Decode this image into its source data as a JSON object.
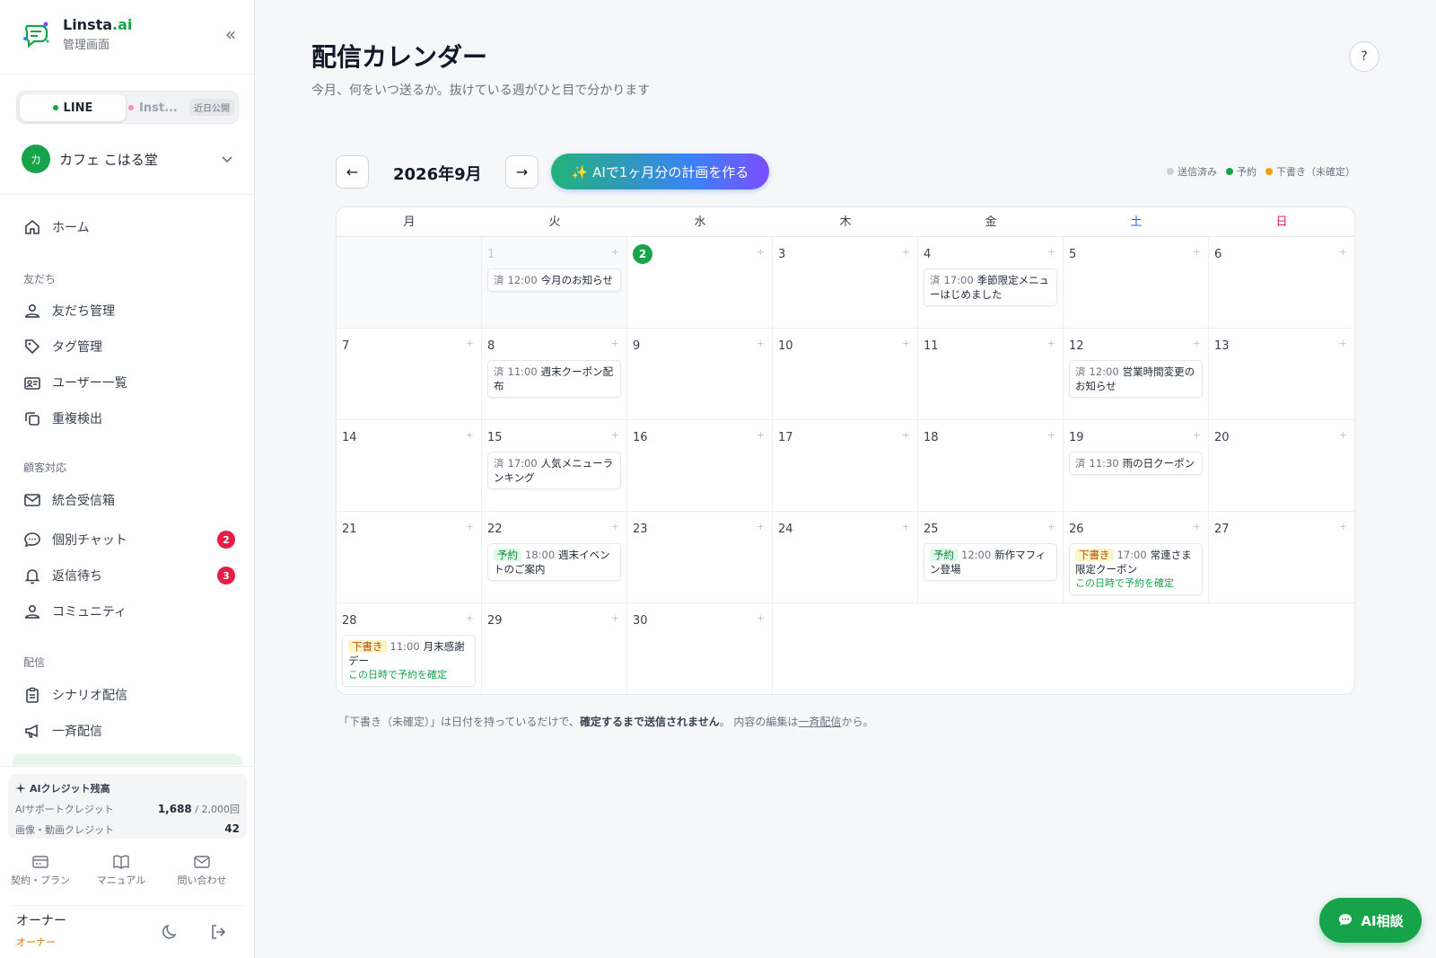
{
  "brand": {
    "name_main": "Linsta",
    "name_accent": ".ai",
    "subtitle": "管理画面"
  },
  "channel_switch": {
    "line": "LINE",
    "instagram": "Inst...",
    "instagram_badge": "近日公開"
  },
  "account": {
    "initial": "カ",
    "name": "カフェ こはる堂"
  },
  "nav": {
    "home": "ホーム",
    "section_friends": "友だち",
    "friends_manage": "友だち管理",
    "tag_manage": "タグ管理",
    "user_list": "ユーザー一覧",
    "duplicate_detect": "重複検出",
    "section_support": "顧客対応",
    "inbox": "統合受信箱",
    "chat": "個別チャット",
    "chat_badge": "2",
    "waiting": "返信待ち",
    "waiting_badge": "3",
    "community": "コミュニティ",
    "section_delivery": "配信",
    "scenario": "シナリオ配信",
    "broadcast": "一斉配信"
  },
  "credits": {
    "title": "AIクレジット残高",
    "support_label": "AIサポートクレジット",
    "support_value": "1,688",
    "support_max": " / 2,000回",
    "media_label": "画像・動画クレジット",
    "media_value": "42"
  },
  "footer": {
    "plan": "契約・プラン",
    "manual": "マニュアル",
    "contact": "問い合わせ"
  },
  "owner": {
    "name": "オーナー",
    "role": "オーナー"
  },
  "header": {
    "title": "配信カレンダー",
    "subtitle": "今月、何をいつ送るか。抜けている週がひと目で分かります",
    "help": "?"
  },
  "toolbar": {
    "prev": "←",
    "month": "2026年9月",
    "next": "→",
    "ai_plan": "✨ AIで1ヶ月分の計画を作る"
  },
  "legend": {
    "sent": "送信済み",
    "scheduled": "予約",
    "draft": "下書き（未確定）"
  },
  "colors": {
    "sent": "#cbd0d6",
    "scheduled": "#16a34a",
    "draft": "#f59e0b",
    "accent": "#16a34a"
  },
  "weekdays": [
    "月",
    "火",
    "水",
    "木",
    "金",
    "土",
    "日"
  ],
  "labels": {
    "sent": "済",
    "scheduled": "予約",
    "draft": "下書き",
    "confirm": "この日時で予約を確定",
    "plus": "+"
  },
  "days": {
    "d1": "1",
    "d2": "2",
    "d3": "3",
    "d4": "4",
    "d5": "5",
    "d6": "6",
    "d7": "7",
    "d8": "8",
    "d9": "9",
    "d10": "10",
    "d11": "11",
    "d12": "12",
    "d13": "13",
    "d14": "14",
    "d15": "15",
    "d16": "16",
    "d17": "17",
    "d18": "18",
    "d19": "19",
    "d20": "20",
    "d21": "21",
    "d22": "22",
    "d23": "23",
    "d24": "24",
    "d25": "25",
    "d26": "26",
    "d27": "27",
    "d28": "28",
    "d29": "29",
    "d30": "30"
  },
  "events": {
    "e1": {
      "time": "12:00",
      "title": "今月のお知らせ"
    },
    "e4": {
      "time": "17:00",
      "title": "季節限定メニューはじめました"
    },
    "e8": {
      "time": "11:00",
      "title": "週末クーポン配布"
    },
    "e12": {
      "time": "12:00",
      "title": "営業時間変更のお知らせ"
    },
    "e15": {
      "time": "17:00",
      "title": "人気メニューランキング"
    },
    "e19": {
      "time": "11:30",
      "title": "雨の日クーポン"
    },
    "e22": {
      "time": "18:00",
      "title": "週末イベントのご案内"
    },
    "e25": {
      "time": "12:00",
      "title": "新作マフィン登場"
    },
    "e26": {
      "time": "17:00",
      "title": "常連さま限定クーポン"
    },
    "e28": {
      "time": "11:00",
      "title": "月末感謝デー"
    }
  },
  "note": {
    "part1": "「下書き（未確定）」は日付を持っているだけで、",
    "bold": "確定するまで送信されません",
    "part2": "。 内容の編集は",
    "link": "一斉配信",
    "part3": "から。"
  },
  "ai_chat": {
    "label": "AI相談"
  }
}
